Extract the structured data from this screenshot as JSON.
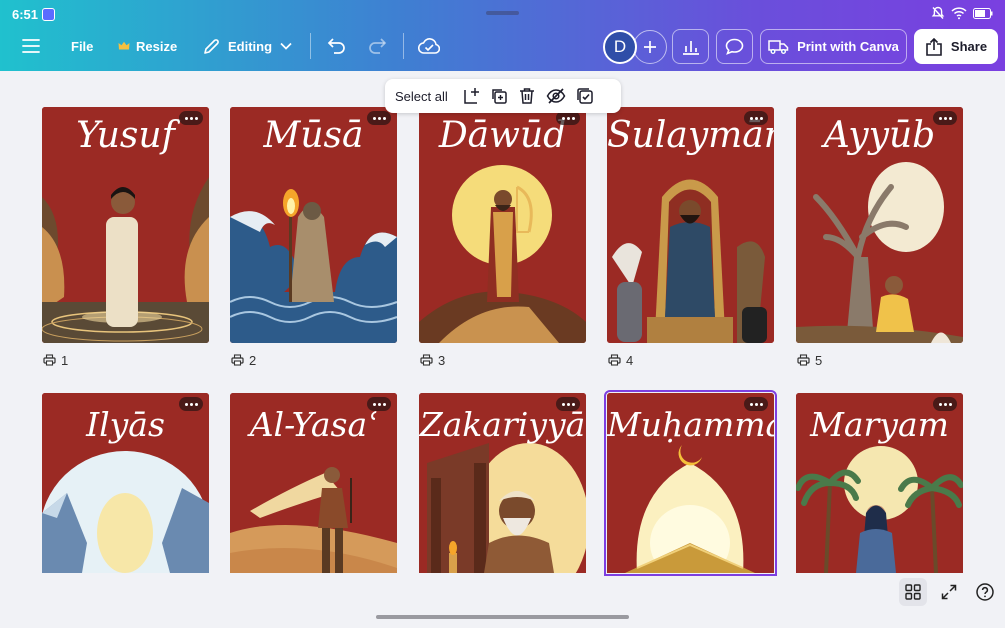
{
  "status": {
    "time": "6:51"
  },
  "toolbar": {
    "file_label": "File",
    "resize_label": "Resize",
    "editing_label": "Editing",
    "avatar_initial": "D",
    "print_label": "Print with Canva",
    "share_label": "Share"
  },
  "selection_bar": {
    "select_all_label": "Select all"
  },
  "pages": [
    {
      "title": "Yusuf",
      "number": "1"
    },
    {
      "title": "Mūsā",
      "number": "2"
    },
    {
      "title": "Dāwūd",
      "number": "3"
    },
    {
      "title": "Sulaymān",
      "number": "4"
    },
    {
      "title": "Ayyūb",
      "number": "5"
    },
    {
      "title": "Ilyās"
    },
    {
      "title": "Al-Yasaʿ"
    },
    {
      "title": "Zakariyyā"
    },
    {
      "title": "Muḥammad"
    },
    {
      "title": "Maryam"
    }
  ],
  "colors": {
    "card_background": "#9b2a24",
    "selection_outline": "#7d3fe0",
    "header_gradient_start": "#20c1ce",
    "header_gradient_end": "#7a3fe0"
  }
}
